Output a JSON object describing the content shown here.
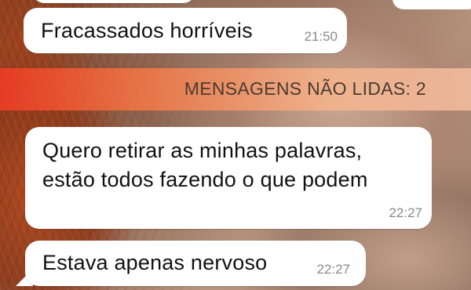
{
  "conversation": {
    "messages": [
      {
        "text": "Fracassados horríveis",
        "time": "21:50"
      },
      {
        "line1": "Quero retirar as minhas palavras,",
        "line2": "estão todos fazendo o que podem",
        "time": "22:27"
      },
      {
        "text": "Estava apenas nervoso",
        "time": "22:27"
      }
    ],
    "unread_banner": "MENSAGENS NÃO LIDAS: 2"
  },
  "colors": {
    "bubble": "#ffffff",
    "time_text": "#8a8a8a",
    "banner_start": "#f03c23",
    "banner_end": "#f5bea0"
  }
}
